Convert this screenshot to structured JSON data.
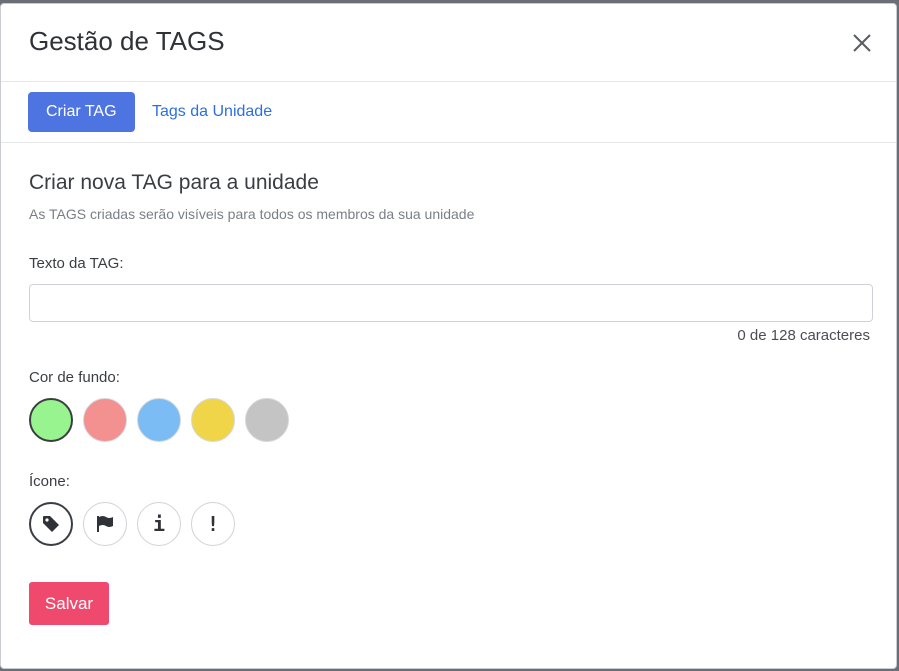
{
  "modal": {
    "title": "Gestão de TAGS"
  },
  "tabs": [
    {
      "label": "Criar TAG",
      "active": true
    },
    {
      "label": "Tags da Unidade",
      "active": false
    }
  ],
  "form": {
    "section_title": "Criar nova TAG para a unidade",
    "section_subtitle": "As TAGS criadas serão visíveis para todos os membros da sua unidade",
    "text_label": "Texto da TAG:",
    "text_value": "",
    "counter": "0 de 128 caracteres",
    "color_label": "Cor de fundo:",
    "colors": [
      {
        "name": "green",
        "hex": "#98f48f",
        "selected": true
      },
      {
        "name": "red",
        "hex": "#f39090",
        "selected": false
      },
      {
        "name": "blue",
        "hex": "#7bbcf5",
        "selected": false
      },
      {
        "name": "yellow",
        "hex": "#f1d548",
        "selected": false
      },
      {
        "name": "gray",
        "hex": "#c4c4c4",
        "selected": false
      }
    ],
    "icon_label": "Ícone:",
    "icons": [
      {
        "name": "tag-icon",
        "selected": true
      },
      {
        "name": "flag-icon",
        "selected": false
      },
      {
        "name": "info-icon",
        "glyph": "i",
        "selected": false
      },
      {
        "name": "exclamation-icon",
        "glyph": "!",
        "selected": false
      }
    ],
    "save_label": "Salvar"
  }
}
